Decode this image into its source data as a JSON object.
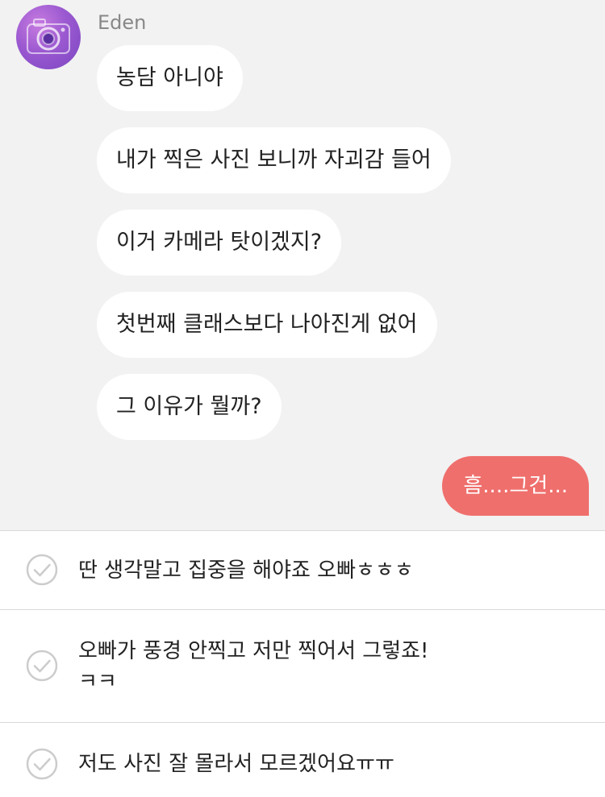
{
  "conversation": {
    "sender": {
      "name": "Eden",
      "avatar_icon": "camera-icon"
    },
    "incoming_messages": [
      "농담 아니야",
      "내가 찍은 사진 보니까 자괴감 들어",
      "이거 카메라 탓이겠지?",
      "첫번째 클래스보다 나아진게 없어",
      "그 이유가 뭘까?"
    ],
    "outgoing_message": "흠....그건..."
  },
  "reply_options": [
    {
      "text": "딴 생각말고 집중을 해야죠 오빠ㅎㅎㅎ",
      "icon": "check-circle-icon"
    },
    {
      "text": "오빠가 풍경 안찍고 저만 찍어서 그렇죠!\nㅋㅋ",
      "icon": "check-circle-icon"
    },
    {
      "text": "저도 사진 잘 몰라서 모르겠어요ㅠㅠ",
      "icon": "check-circle-icon"
    }
  ],
  "colors": {
    "chat_background": "#f2f2f2",
    "incoming_bubble": "#ffffff",
    "outgoing_bubble": "#ef6f6c",
    "check_icon": "#cccccc",
    "divider": "#d9d9d9"
  }
}
